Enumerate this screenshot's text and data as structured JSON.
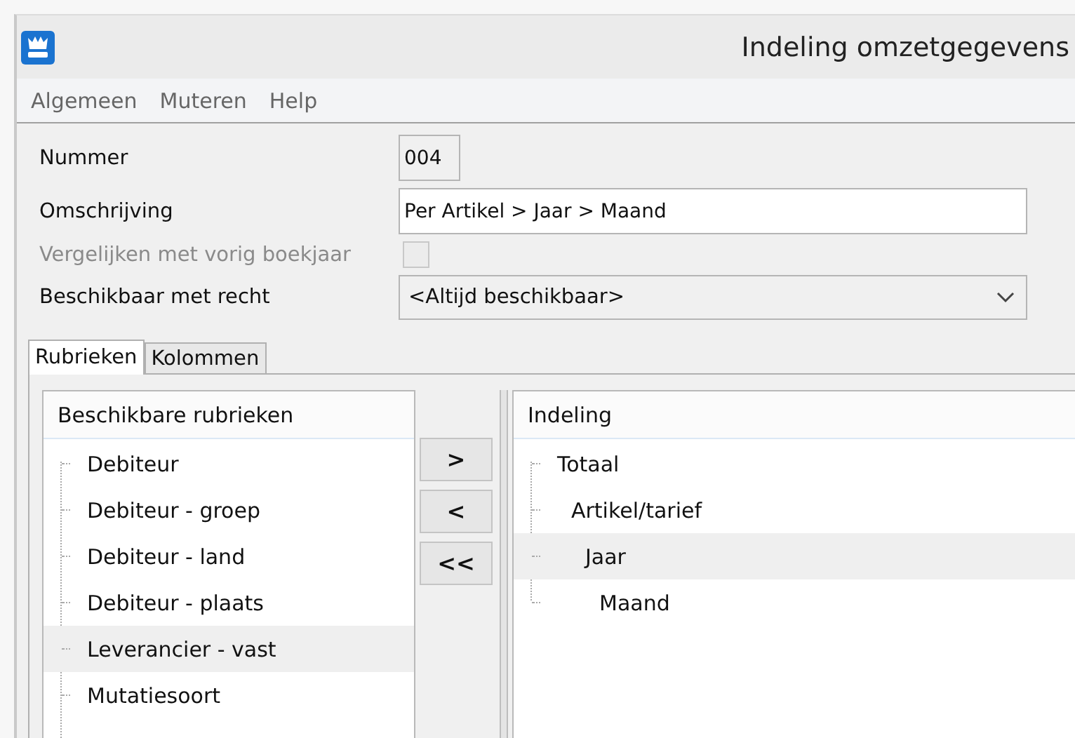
{
  "window": {
    "title": "Indeling omzetgegevens"
  },
  "menu": [
    "Algemeen",
    "Muteren",
    "Help"
  ],
  "form": {
    "number": {
      "label": "Nummer",
      "value": "004"
    },
    "description": {
      "label": "Omschrijving",
      "value": "Per Artikel > Jaar > Maand"
    },
    "compare": {
      "label": "Vergelijken met vorig boekjaar",
      "checked": false,
      "disabled": true
    },
    "availability": {
      "label": "Beschikbaar met recht",
      "value": "<Altijd beschikbaar>"
    }
  },
  "tabs": [
    {
      "label": "Rubrieken",
      "selected": true
    },
    {
      "label": "Kolommen",
      "selected": false
    }
  ],
  "available": {
    "header": "Beschikbare rubrieken",
    "items": [
      {
        "label": "Debiteur",
        "selected": false
      },
      {
        "label": "Debiteur - groep",
        "selected": false
      },
      {
        "label": "Debiteur - land",
        "selected": false
      },
      {
        "label": "Debiteur - plaats",
        "selected": false
      },
      {
        "label": "Leverancier - vast",
        "selected": true
      },
      {
        "label": "Mutatiesoort",
        "selected": false
      }
    ]
  },
  "move_buttons": [
    ">",
    "<",
    "<<"
  ],
  "layout": {
    "header": "Indeling",
    "tree": [
      {
        "label": "Totaal",
        "selected": false,
        "children": [
          {
            "label": "Artikel/tarief",
            "selected": false,
            "children": [
              {
                "label": "Jaar",
                "selected": true,
                "children": [
                  {
                    "label": "Maand",
                    "selected": false
                  }
                ]
              }
            ]
          }
        ]
      }
    ]
  }
}
